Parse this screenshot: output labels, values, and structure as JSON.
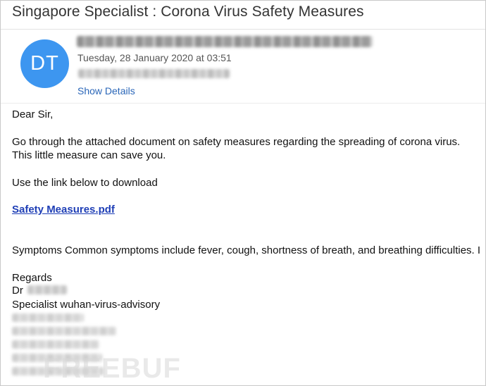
{
  "header": {
    "subject": "Singapore Specialist  : Corona Virus Safety Measures",
    "avatar_initials": "DT",
    "date": "Tuesday, 28 January 2020 at 03:51",
    "show_details_label": "Show Details"
  },
  "body": {
    "greeting": "Dear Sir,",
    "para1_line1": "Go through the attached document on safety measures regarding the spreading of corona virus.",
    "para1_line2": "This little measure can save you.",
    "para2": "Use the link below to download",
    "link_text": "Safety Measures.pdf",
    "symptoms": "Symptoms  Common symptoms include fever, cough, shortness of breath, and breathing difficulties. I",
    "regards": "Regards",
    "dr_prefix": "Dr",
    "signature_title": "Specialist wuhan-virus-advisory"
  },
  "watermark": "FREEBUF",
  "colors": {
    "avatar": "#3d96f0",
    "link": "#1f3fb6",
    "show_details": "#2a66b8"
  }
}
